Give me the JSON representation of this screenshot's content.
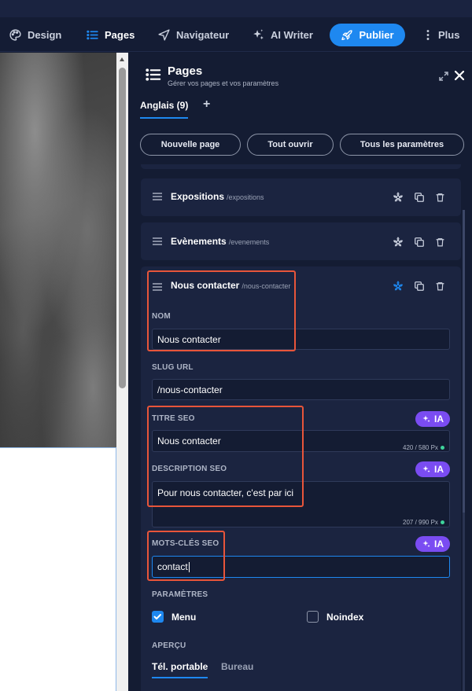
{
  "toolbar": {
    "design": "Design",
    "pages": "Pages",
    "navigator": "Navigateur",
    "ai_writer": "AI Writer",
    "publish": "Publier",
    "more": "Plus"
  },
  "panel": {
    "title": "Pages",
    "subtitle": "Gérer vos pages et vos paramètres",
    "lang_tab": "Anglais (9)",
    "add_tab": "+",
    "btn_new": "Nouvelle page",
    "btn_open_all": "Tout ouvrir",
    "btn_all_params": "Tous les paramètres"
  },
  "pages": [
    {
      "name": "Expositions",
      "slug": "/expositions"
    },
    {
      "name": "Evènements",
      "slug": "/evenements"
    },
    {
      "name": "Nous contacter",
      "slug": "/nous-contacter"
    }
  ],
  "form": {
    "nom_label": "NOM",
    "nom_value": "Nous contacter",
    "slug_label": "SLUG URL",
    "slug_value": "/nous-contacter",
    "seo_title_label": "TITRE SEO",
    "seo_title_value": "Nous contacter",
    "seo_title_counter": "420 / 580 Px",
    "seo_desc_label": "DESCRIPTION SEO",
    "seo_desc_value": "Pour nous contacter, c'est par ici",
    "seo_desc_counter": "207 / 990 Px",
    "keywords_label": "MOTS-CLÉS SEO",
    "keywords_value": "contact",
    "ia_label": "IA",
    "params_label": "PARAMÈTRES",
    "menu_label": "Menu",
    "menu_checked": true,
    "noindex_label": "Noindex",
    "noindex_checked": false,
    "preview_label": "APERÇU",
    "preview_tabs": [
      "Tél. portable",
      "Bureau"
    ]
  },
  "colors": {
    "accent": "#1e88f0",
    "ia": "#7a4cf2",
    "highlight": "#e8553a",
    "counter_ok": "#3ed39b"
  }
}
